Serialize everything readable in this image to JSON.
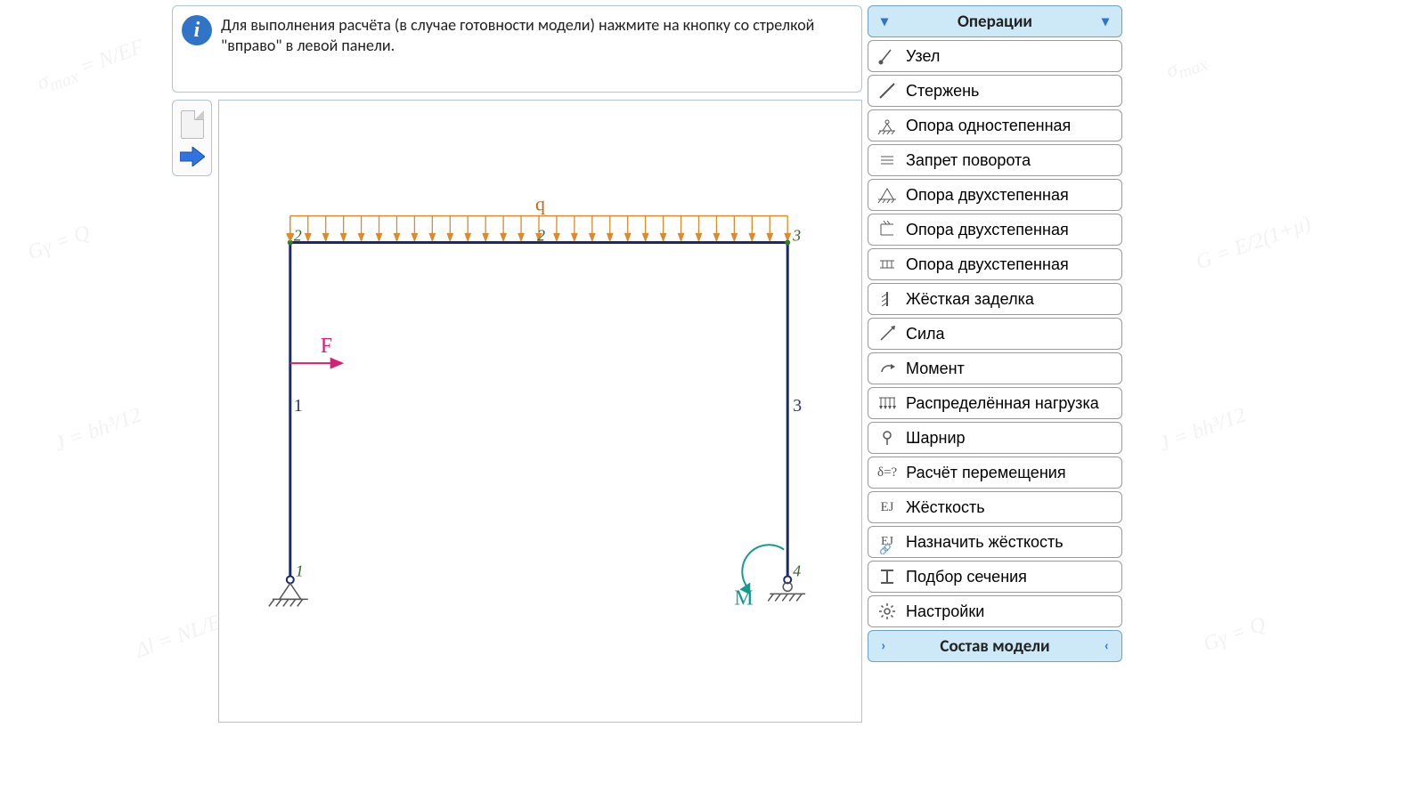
{
  "header": {
    "message": "Для выполнения расчёта (в случае готовности модели) нажмите на кнопку со стрелкой \"вправо\" в левой панели."
  },
  "left_tools": {
    "new_model": "Новая модель",
    "run": "Выполнить расчёт"
  },
  "panel": {
    "header": "Операции",
    "footer": "Состав модели",
    "items": [
      {
        "id": "node",
        "label": "Узел"
      },
      {
        "id": "bar",
        "label": "Стержень"
      },
      {
        "id": "support-1dof",
        "label": "Опора одностепенная"
      },
      {
        "id": "rotation-lock",
        "label": "Запрет поворота"
      },
      {
        "id": "support-2dof-a",
        "label": "Опора двухстепенная"
      },
      {
        "id": "support-2dof-b",
        "label": "Опора двухстепенная"
      },
      {
        "id": "support-2dof-c",
        "label": "Опора двухстепенная"
      },
      {
        "id": "fixed-support",
        "label": "Жёсткая заделка"
      },
      {
        "id": "force",
        "label": "Сила"
      },
      {
        "id": "moment",
        "label": "Момент"
      },
      {
        "id": "distributed-load",
        "label": "Распределённая нагрузка"
      },
      {
        "id": "hinge",
        "label": "Шарнир"
      },
      {
        "id": "displacement",
        "label": "Расчёт перемещения"
      },
      {
        "id": "stiffness",
        "label": "Жёсткость"
      },
      {
        "id": "assign-stiffness",
        "label": "Назначить жёсткость"
      },
      {
        "id": "section",
        "label": "Подбор сечения"
      },
      {
        "id": "settings",
        "label": "Настройки"
      }
    ]
  },
  "chart_data": {
    "type": "frame-scheme",
    "title": "",
    "units": "",
    "nodes": [
      {
        "id": 1,
        "x": 0,
        "y": 0,
        "support": "pin-2dof"
      },
      {
        "id": 2,
        "x": 0,
        "y": 4
      },
      {
        "id": 3,
        "x": 6,
        "y": 4
      },
      {
        "id": 4,
        "x": 6,
        "y": 0,
        "support": "roller"
      }
    ],
    "bars": [
      {
        "id": 1,
        "from": 1,
        "to": 2
      },
      {
        "id": 2,
        "from": 2,
        "to": 3
      },
      {
        "id": 3,
        "from": 3,
        "to": 4
      }
    ],
    "loads": {
      "distributed": [
        {
          "bar": 2,
          "name": "q",
          "dir": "down"
        }
      ],
      "point_forces": [
        {
          "bar": 1,
          "pos": 0.65,
          "name": "F",
          "dir": "+x"
        }
      ],
      "moments": [
        {
          "node": 4,
          "name": "M",
          "sense": "ccw"
        }
      ]
    },
    "labels": {
      "q": "q",
      "F": "F",
      "M": "M"
    }
  }
}
